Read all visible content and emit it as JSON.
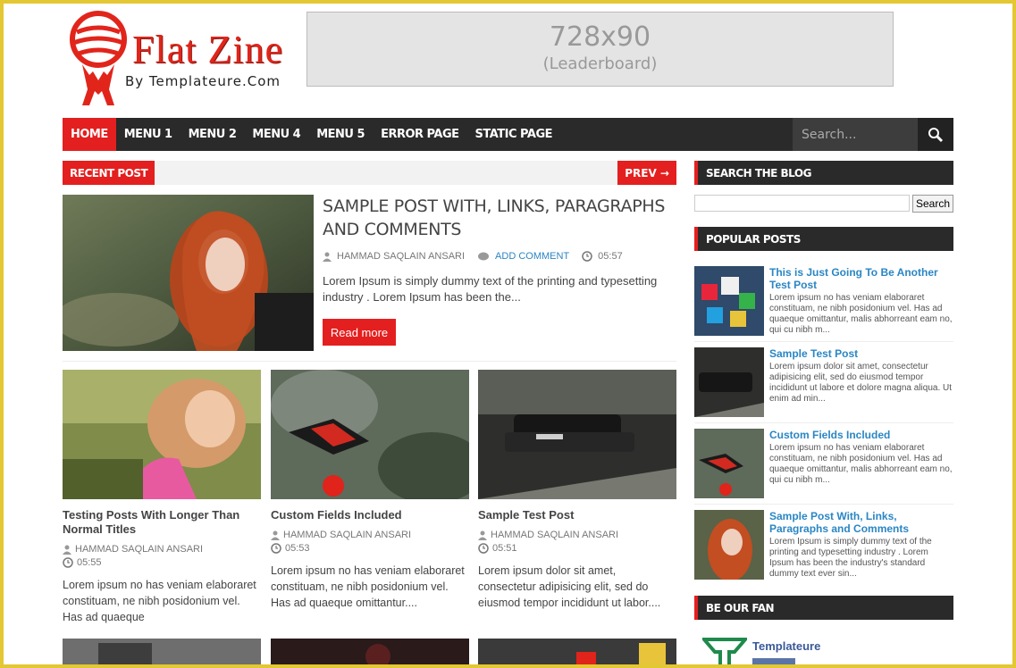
{
  "header": {
    "logo_title": "Flat Zine",
    "logo_byline": "By Templateure.Com",
    "ad_size": "728x90",
    "ad_label": "(Leaderboard)"
  },
  "nav": {
    "items": [
      "HOME",
      "MENU 1",
      "MENU 2",
      "MENU 4",
      "MENU 5",
      "ERROR PAGE",
      "STATIC PAGE"
    ],
    "search_placeholder": "Search..."
  },
  "recent": {
    "label": "RECENT POST",
    "prev_label": "PREV →"
  },
  "featured": {
    "title": "SAMPLE POST WITH, LINKS, PARAGRAPHS AND COMMENTS",
    "author": "HAMMAD SAQLAIN ANSARI",
    "comment_link": "ADD COMMENT",
    "time": "05:57",
    "excerpt": "Lorem Ipsum is simply dummy text of the printing and typesetting industry . Lorem Ipsum has been the...",
    "read_more": "Read more"
  },
  "grid_posts": [
    {
      "title": "Testing Posts With Longer Than Normal Titles",
      "author": "HAMMAD SAQLAIN ANSARI",
      "time": "05:55",
      "excerpt": "Lorem ipsum no has veniam elaboraret constituam, ne nibh posidonium vel. Has ad quaeque"
    },
    {
      "title": "Custom Fields Included",
      "author": "HAMMAD SAQLAIN ANSARI",
      "time": "05:53",
      "excerpt": "Lorem ipsum no has veniam elaboraret constituam, ne nibh posidonium vel. Has ad quaeque omittantur...."
    },
    {
      "title": "Sample Test Post",
      "author": "HAMMAD SAQLAIN ANSARI",
      "time": "05:51",
      "excerpt": "Lorem ipsum dolor sit amet, consectetur adipisicing elit, sed do eiusmod tempor incididunt ut labor...."
    }
  ],
  "sidebar": {
    "search_heading": "SEARCH THE BLOG",
    "search_button": "Search",
    "popular_heading": "POPULAR POSTS",
    "popular": [
      {
        "title": "This is Just Going To Be Another Test Post",
        "excerpt": "Lorem ipsum no has veniam elaboraret constituam, ne nibh posidonium vel. Has ad quaeque omittantur, malis abhorreant eam no, qui cu nibh m..."
      },
      {
        "title": "Sample Test Post",
        "excerpt": "Lorem ipsum dolor sit amet, consectetur adipisicing elit, sed do eiusmod tempor incididunt ut labore et dolore magna aliqua. Ut enim ad min..."
      },
      {
        "title": "Custom Fields Included",
        "excerpt": "Lorem ipsum no has veniam elaboraret constituam, ne nibh posidonium vel. Has ad quaeque omittantur, malis abhorreant eam no, qui cu nibh m..."
      },
      {
        "title": "Sample Post With, Links, Paragraphs and Comments",
        "excerpt": "Lorem Ipsum is simply dummy text of the printing and typesetting industry . Lorem Ipsum has been the industry's standard dummy text ever sin..."
      }
    ],
    "fan_heading": "BE OUR FAN",
    "fan_name": "Templateure"
  },
  "colors": {
    "accent": "#e41f1f",
    "nav_bg": "#2a2a2a",
    "link": "#2a86c4",
    "frame": "#e3c733"
  }
}
